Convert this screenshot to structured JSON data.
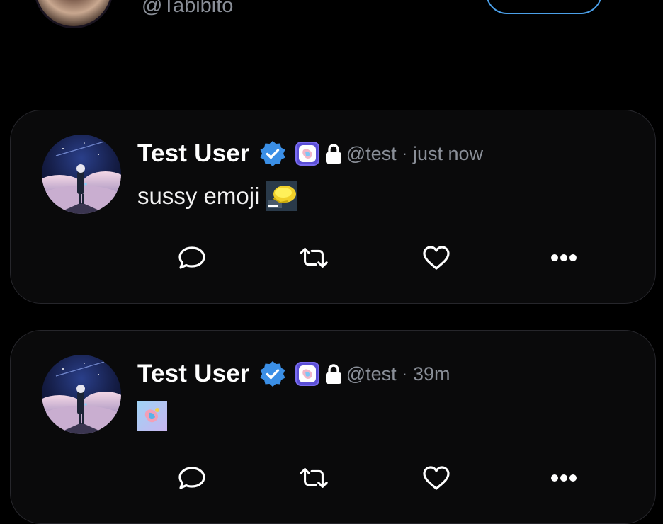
{
  "profile": {
    "handle": "@Tabibito"
  },
  "posts": [
    {
      "author_name": "Test User",
      "handle": "@test",
      "separator": "·",
      "time": "just now",
      "text": "sussy emoji",
      "emoji": "custom-emoji-sussy-icon",
      "icons": [
        "verified-badge-icon",
        "app-badge-icon",
        "lock-icon"
      ],
      "actions": [
        "reply-icon",
        "repost-icon",
        "like-icon",
        "more-icon"
      ]
    },
    {
      "author_name": "Test User",
      "handle": "@test",
      "separator": "·",
      "time": "39m",
      "text": "",
      "emoji": "custom-emoji-app-icon",
      "icons": [
        "verified-badge-icon",
        "app-badge-icon",
        "lock-icon"
      ],
      "actions": [
        "reply-icon",
        "repost-icon",
        "like-icon",
        "more-icon"
      ]
    }
  ],
  "colors": {
    "background": "#000000",
    "card": "#0a0a0b",
    "muted_text": "#8a8f98",
    "accent_blue": "#4b9fe8",
    "verified_blue": "#3b8fe6"
  }
}
